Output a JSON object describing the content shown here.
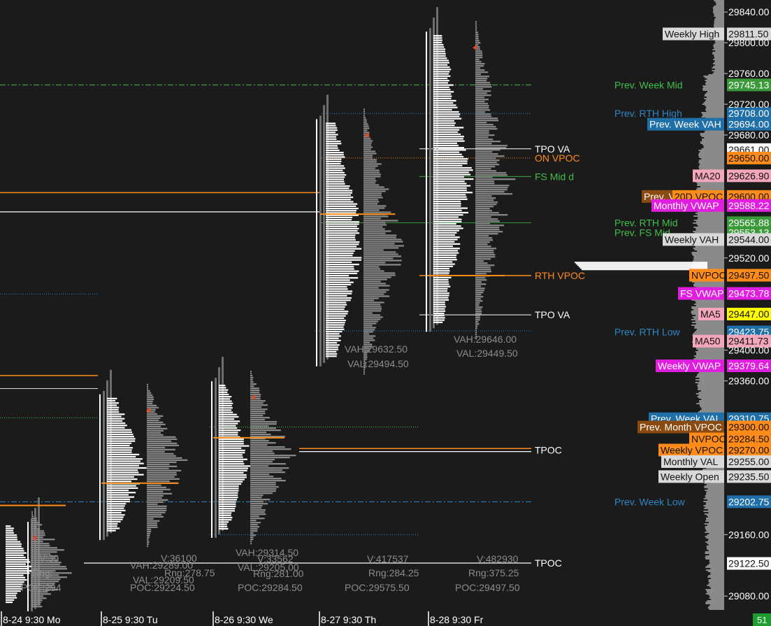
{
  "chart_data": {
    "type": "market-profile",
    "y_axis": {
      "ylim": [
        29062,
        29862
      ],
      "ticks": [
        29080,
        29160,
        29360,
        29400,
        29520,
        29680,
        29720,
        29760,
        29800,
        29840
      ]
    },
    "x_axis": {
      "session_labels": [
        "8-24  9:30 Mo",
        "8-25  9:30 Tu",
        "8-26  9:30 We",
        "8-27  9:30 Th",
        "8-28  9:30 Fr"
      ],
      "corner_label": "51"
    },
    "sessions": [
      {
        "name": "8-24",
        "high": 29172,
        "low": 29068,
        "poc_price": 29198,
        "stats": [
          "V:39",
          "Rng:",
          "POC:294"
        ]
      },
      {
        "name": "8-25",
        "high": 29338,
        "low": 29162,
        "poc_price": 29227,
        "stats": [
          "V:36100",
          "VAH:29289.00",
          "Rng:278.75",
          "VAL:29209.50",
          "POC:29224.50"
        ]
      },
      {
        "name": "8-26",
        "high": 29355,
        "low": 29165,
        "poc_price": 29286,
        "stats": [
          "VAH:29314.50",
          "V:33562",
          "VAL:29205.00",
          "Rng:281.00",
          "POC:29284.50"
        ]
      },
      {
        "name": "8-27",
        "high": 29696,
        "low": 29388,
        "poc_price": 29577,
        "stats": [
          "VAH:29632.50",
          "VAL:29494.50",
          "V:417537",
          "Rng:284.25",
          "POC:29575.50"
        ]
      },
      {
        "name": "8-28",
        "high": 29810,
        "low": 29433,
        "poc_price": 29497,
        "stats": [
          "VAH:29646.00",
          "VAL:29449.50",
          "V:482930",
          "Rng:375.25",
          "POC:29497.50"
        ]
      }
    ],
    "level_lines": [
      {
        "label": "TPO VA",
        "price": 29662,
        "color": "#ffffff"
      },
      {
        "label": "ON VPOC",
        "price": 29650,
        "color": "#ff8c1a"
      },
      {
        "label": "FS Mid d",
        "price": 29626,
        "color": "#3fbf4a"
      },
      {
        "label": "RTH VPOC",
        "price": 29497,
        "color": "#ff8c1a"
      },
      {
        "label": "TPO VA",
        "price": 29446,
        "color": "#ffffff"
      },
      {
        "label": "TPOC",
        "price": 29270,
        "color": "#ffffff"
      },
      {
        "label": "TPOC",
        "price": 29123,
        "color": "#ffffff"
      }
    ],
    "price_tags": [
      {
        "label": "Weekly High",
        "value": "29811.50",
        "price": 29811.5,
        "label_bg": "#d9d9d9",
        "label_fg": "#111111",
        "value_bg": "#d9d9d9",
        "value_fg": "#111111"
      },
      {
        "label": "Prev. Week Mid",
        "value": "29745.13",
        "price": 29745.13,
        "label_bg": "",
        "label_fg": "#3fbf4a",
        "value_bg": "#3a9a3a",
        "value_fg": "#ffffff"
      },
      {
        "label": "Prev. RTH High",
        "value": "29708.00",
        "price": 29708,
        "label_bg": "",
        "label_fg": "#2e86c1",
        "value_bg": "#1f6fa8",
        "value_fg": "#ffffff"
      },
      {
        "label": "Prev. Week VAH",
        "value": "29694.00",
        "price": 29694,
        "label_bg": "#1f6fa8",
        "label_fg": "#ffffff",
        "value_bg": "#1f6fa8",
        "value_fg": "#ffffff"
      },
      {
        "label": "",
        "value": "29661.00",
        "price": 29661,
        "label_bg": "",
        "label_fg": "#ffffff",
        "value_bg": "#ffffff",
        "value_fg": "#111111"
      },
      {
        "label": "",
        "value": "29650.00",
        "price": 29650,
        "label_bg": "",
        "label_fg": "#ffffff",
        "value_bg": "#ff8c1a",
        "value_fg": "#111111"
      },
      {
        "label": "MA20",
        "value": "29626.90",
        "price": 29626.9,
        "label_bg": "#f4a6bc",
        "label_fg": "#111111",
        "value_bg": "#f4a6bc",
        "value_fg": "#111111"
      },
      {
        "label": "Prev. V",
        "value": "29600.00",
        "price": 29600,
        "label_bg": "#8b4a0f",
        "label_fg": "#ffffff",
        "value_bg": "#ff8c1a",
        "value_fg": "#111111"
      },
      {
        "label": "20D VPOC",
        "value": "",
        "price": 29600,
        "label_bg": "#ff8c1a",
        "label_fg": "#111111",
        "value_bg": "",
        "value_fg": "#111111"
      },
      {
        "label": "Monthly VWAP",
        "value": "29588.22",
        "price": 29588.22,
        "label_bg": "#e01ee0",
        "label_fg": "#ffffff",
        "value_bg": "#e01ee0",
        "value_fg": "#ffffff"
      },
      {
        "label": "Prev. RTH Mid",
        "value": "29565.88",
        "price": 29565.88,
        "label_bg": "",
        "label_fg": "#3fbf4a",
        "value_bg": "#3a9a3a",
        "value_fg": "#ffffff"
      },
      {
        "label": "Prev. FS Mid",
        "value": "29553.13",
        "price": 29553.13,
        "label_bg": "",
        "label_fg": "#3fbf4a",
        "value_bg": "#3a9a3a",
        "value_fg": "#ffffff"
      },
      {
        "label": "Weekly VAH",
        "value": "29544.00",
        "price": 29544,
        "label_bg": "#d9d9d9",
        "label_fg": "#111111",
        "value_bg": "#d9d9d9",
        "value_fg": "#111111"
      },
      {
        "label": "NVPOC",
        "value": "29497.50",
        "price": 29497.5,
        "label_bg": "#ff8c1a",
        "label_fg": "#111111",
        "value_bg": "#ff8c1a",
        "value_fg": "#111111"
      },
      {
        "label": "FS VWAP",
        "value": "29473.78",
        "price": 29473.78,
        "label_bg": "#e01ee0",
        "label_fg": "#ffffff",
        "value_bg": "#e01ee0",
        "value_fg": "#ffffff"
      },
      {
        "label": "MA5",
        "value": "29447.00",
        "price": 29447,
        "label_bg": "#f4a6bc",
        "label_fg": "#111111",
        "value_bg": "#ffff00",
        "value_fg": "#111111"
      },
      {
        "label": "Prev. RTH Low",
        "value": "29423.75",
        "price": 29423.75,
        "label_bg": "",
        "label_fg": "#2e86c1",
        "value_bg": "#1f6fa8",
        "value_fg": "#ffffff"
      },
      {
        "label": "MA50",
        "value": "29411.73",
        "price": 29411.73,
        "label_bg": "#f4a6bc",
        "label_fg": "#111111",
        "value_bg": "#f4a6bc",
        "value_fg": "#111111"
      },
      {
        "label": "Weekly VWAP",
        "value": "29379.64",
        "price": 29379.64,
        "label_bg": "#e01ee0",
        "label_fg": "#ffffff",
        "value_bg": "#e01ee0",
        "value_fg": "#ffffff"
      },
      {
        "label": "Prev. Week VAL",
        "value": "29310.75",
        "price": 29310.75,
        "label_bg": "#1f6fa8",
        "label_fg": "#ffffff",
        "value_bg": "#1f6fa8",
        "value_fg": "#ffffff"
      },
      {
        "label": "Prev. Month VPOC",
        "value": "29300.00",
        "price": 29300,
        "label_bg": "#8b4a0f",
        "label_fg": "#ffffff",
        "value_bg": "#ff8c1a",
        "value_fg": "#111111"
      },
      {
        "label": "NVPOC",
        "value": "29284.50",
        "price": 29284.5,
        "label_bg": "#ff8c1a",
        "label_fg": "#111111",
        "value_bg": "#ff8c1a",
        "value_fg": "#111111"
      },
      {
        "label": "Weekly VPOC",
        "value": "29270.00",
        "price": 29270,
        "label_bg": "#ff8c1a",
        "label_fg": "#111111",
        "value_bg": "#ff8c1a",
        "value_fg": "#111111"
      },
      {
        "label": "Monthly VAL",
        "value": "29255.00",
        "price": 29255,
        "label_bg": "#d9d9d9",
        "label_fg": "#111111",
        "value_bg": "#d9d9d9",
        "value_fg": "#111111"
      },
      {
        "label": "Weekly Open",
        "value": "29235.50",
        "price": 29235.5,
        "label_bg": "#d9d9d9",
        "label_fg": "#111111",
        "value_bg": "#d9d9d9",
        "value_fg": "#111111"
      },
      {
        "label": "Prev. Week Low",
        "value": "29202.75",
        "price": 29202.75,
        "label_bg": "",
        "label_fg": "#2e86c1",
        "value_bg": "#1f6fa8",
        "value_fg": "#ffffff"
      },
      {
        "label": "",
        "value": "29122.50",
        "price": 29122.5,
        "label_bg": "",
        "label_fg": "#ffffff",
        "value_bg": "#ffffff",
        "value_fg": "#111111"
      }
    ],
    "colors": {
      "background": "#1b1b1b",
      "profile_white": "#ffffff",
      "profile_grey": "#6e6e6e",
      "volume_grey": "#8a8a8a",
      "poc_orange": "#ff8c1a",
      "stats_text": "#8c8c8c",
      "axis_text": "#ffffff",
      "green_level": "#3fbf4a",
      "blue_level": "#2e86c1",
      "corner_bg": "#1e9e2e"
    }
  }
}
